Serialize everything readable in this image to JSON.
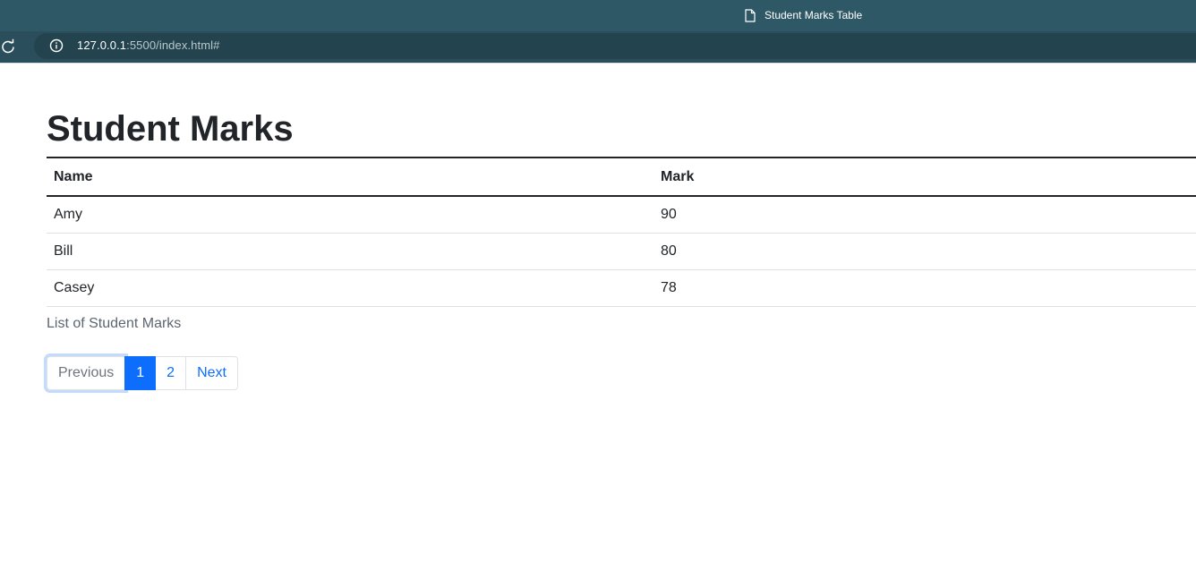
{
  "browser": {
    "tab_title": "Student Marks Table",
    "url_host": "127.0.0.1",
    "url_rest": ":5500/index.html#",
    "colors": {
      "titlebar": "#2f5866",
      "urlbar": "#2a4e5b"
    }
  },
  "page": {
    "title": "Student Marks",
    "table": {
      "headers": [
        "Name",
        "Mark"
      ],
      "rows": [
        [
          "Amy",
          "90"
        ],
        [
          "Bill",
          "80"
        ],
        [
          "Casey",
          "78"
        ]
      ]
    },
    "caption": "List of Student Marks",
    "pagination": {
      "previous": "Previous",
      "pages": [
        "1",
        "2"
      ],
      "active_page": "1",
      "next": "Next"
    },
    "colors": {
      "accent": "#0d6efd",
      "text": "#212529"
    }
  }
}
